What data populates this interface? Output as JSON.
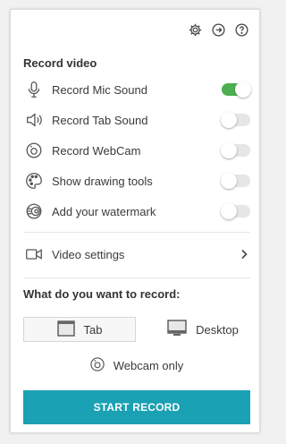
{
  "header": {
    "icons": [
      "gear-icon",
      "sign-out-icon",
      "help-icon"
    ]
  },
  "record_video": {
    "title": "Record video",
    "options": [
      {
        "label": "Record Mic Sound",
        "icon": "microphone-icon",
        "enabled": true
      },
      {
        "label": "Record Tab Sound",
        "icon": "speaker-icon",
        "enabled": false
      },
      {
        "label": "Record WebCam",
        "icon": "webcam-icon",
        "enabled": false
      },
      {
        "label": "Show drawing tools",
        "icon": "palette-icon",
        "enabled": false
      },
      {
        "label": "Add your watermark",
        "icon": "watermark-icon",
        "enabled": false
      }
    ]
  },
  "video_settings": {
    "label": "Video settings",
    "icon": "video-camera-icon"
  },
  "record_target": {
    "title": "What do you want to record:",
    "tab_label": "Tab",
    "desktop_label": "Desktop",
    "webcam_only_label": "Webcam only",
    "selected": "Tab"
  },
  "start_button": {
    "label": "START RECORD"
  },
  "colors": {
    "accent": "#1aa1b3",
    "toggle_on": "#4caf50",
    "toggle_off": "#e6e6e6"
  }
}
